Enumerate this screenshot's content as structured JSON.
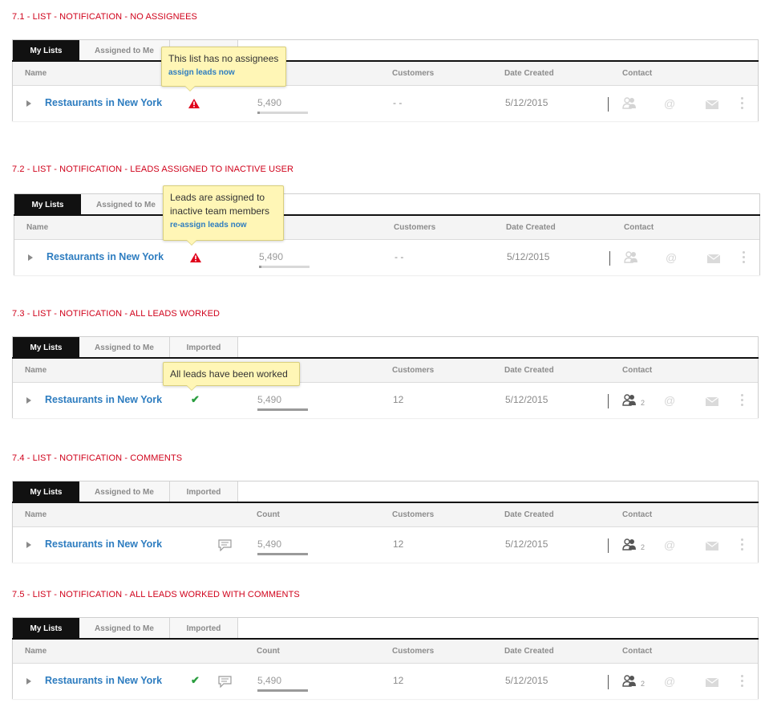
{
  "colors": {
    "section_title": "#d0021b",
    "link": "#2e7dc0",
    "tab_active_bg": "#111111",
    "tooltip_bg": "#fff6b6",
    "check": "#2a9d3f",
    "warning": "#e0001b"
  },
  "sections": [
    {
      "title": "7.1 - LIST - NOTIFICATION - NO ASSIGNEES",
      "tabs": [
        "My Lists",
        "Assigned to Me",
        ""
      ],
      "headers": {
        "name": "Name",
        "count": "",
        "customers": "Customers",
        "date": "Date Created",
        "contact": "Contact"
      },
      "row": {
        "name": "Restaurants in New York",
        "count": "5,490",
        "count_progress": 0.05,
        "customers": "- -",
        "date": "5/12/2015",
        "people_count": "",
        "status_icon": "warning-icon",
        "comment_icon": false
      },
      "tooltip": {
        "message": "This list has no assignees",
        "link": "assign leads now"
      }
    },
    {
      "title": "7.2 - LIST - NOTIFICATION - LEADS ASSIGNED TO INACTIVE USER",
      "tabs": [
        "My Lists",
        "Assigned to Me",
        ""
      ],
      "headers": {
        "name": "Name",
        "count": "",
        "customers": "Customers",
        "date": "Date Created",
        "contact": "Contact"
      },
      "row": {
        "name": "Restaurants in New York",
        "count": "5,490",
        "count_progress": 0.05,
        "customers": "- -",
        "date": "5/12/2015",
        "people_count": "",
        "status_icon": "warning-icon",
        "comment_icon": false
      },
      "tooltip": {
        "message": "Leads are assigned to inactive team members",
        "link": "re-assign leads now"
      }
    },
    {
      "title": "7.3 - LIST - NOTIFICATION - ALL LEADS WORKED",
      "tabs": [
        "My Lists",
        "Assigned to Me",
        "Imported"
      ],
      "headers": {
        "name": "Name",
        "count": "",
        "customers": "Customers",
        "date": "Date Created",
        "contact": "Contact"
      },
      "row": {
        "name": "Restaurants in New York",
        "count": "5,490",
        "count_progress": 1.0,
        "customers": "12",
        "date": "5/12/2015",
        "people_count": "2",
        "status_icon": "check-icon",
        "comment_icon": false
      },
      "tooltip": {
        "message": "All leads have been worked",
        "link": ""
      }
    },
    {
      "title": "7.4 - LIST - NOTIFICATION - COMMENTS",
      "tabs": [
        "My Lists",
        "Assigned to Me",
        "Imported"
      ],
      "headers": {
        "name": "Name",
        "count": "Count",
        "customers": "Customers",
        "date": "Date Created",
        "contact": "Contact"
      },
      "row": {
        "name": "Restaurants in New York",
        "count": "5,490",
        "count_progress": 1.0,
        "customers": "12",
        "date": "5/12/2015",
        "people_count": "2",
        "status_icon": "",
        "comment_icon": true
      }
    },
    {
      "title": "7.5 - LIST - NOTIFICATION - ALL LEADS WORKED WITH COMMENTS",
      "tabs": [
        "My Lists",
        "Assigned to Me",
        "Imported"
      ],
      "headers": {
        "name": "Name",
        "count": "Count",
        "customers": "Customers",
        "date": "Date Created",
        "contact": "Contact"
      },
      "row": {
        "name": "Restaurants in New York",
        "count": "5,490",
        "count_progress": 1.0,
        "customers": "12",
        "date": "5/12/2015",
        "people_count": "2",
        "status_icon": "check-icon",
        "comment_icon": true
      }
    }
  ]
}
